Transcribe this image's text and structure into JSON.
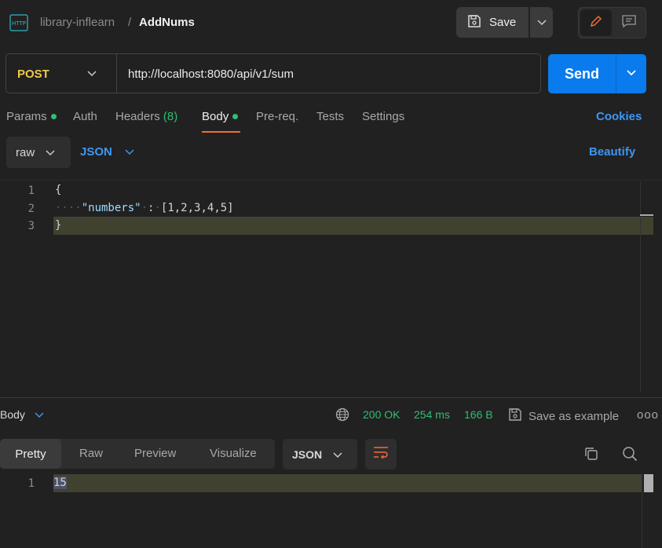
{
  "header": {
    "breadcrumb_parent": "library-inflearn",
    "breadcrumb_separator": "/",
    "request_name": "AddNums",
    "save_label": "Save",
    "icons": [
      "http-icon",
      "save-icon",
      "chevron-down-icon",
      "pencil-icon",
      "comment-icon"
    ]
  },
  "request": {
    "method": "POST",
    "url": "http://localhost:8080/api/v1/sum",
    "send_label": "Send"
  },
  "tabs": [
    {
      "label": "Params",
      "dot": true
    },
    {
      "label": "Auth"
    },
    {
      "label": "Headers",
      "count": "(8)"
    },
    {
      "label": "Body",
      "dot": true,
      "active": true
    },
    {
      "label": "Pre-req."
    },
    {
      "label": "Tests"
    },
    {
      "label": "Settings"
    }
  ],
  "cookies_label": "Cookies",
  "body_options": {
    "mode": "raw",
    "language": "JSON",
    "beautify_label": "Beautify"
  },
  "editor": {
    "line_numbers": [
      "1",
      "2",
      "3"
    ],
    "lines": [
      "{",
      "    \"numbers\" : [1,2,3,4,5]",
      "}"
    ],
    "key": "\"numbers\"",
    "value": "[1,2,3,4,5]"
  },
  "response": {
    "section_label": "Body",
    "status": "200 OK",
    "time": "254 ms",
    "size": "166 B",
    "save_example_label": "Save as example",
    "more_label": "ooo",
    "view_tabs": [
      "Pretty",
      "Raw",
      "Preview",
      "Visualize"
    ],
    "active_view": "Pretty",
    "format": "JSON",
    "line_numbers": [
      "1"
    ],
    "lines": [
      "15"
    ]
  },
  "colors": {
    "accent_blue": "#097bed",
    "link_blue": "#3d96f5",
    "method_yellow": "#f2c94c",
    "status_green": "#2fbf71",
    "active_tab_underline": "#f26b3a"
  }
}
